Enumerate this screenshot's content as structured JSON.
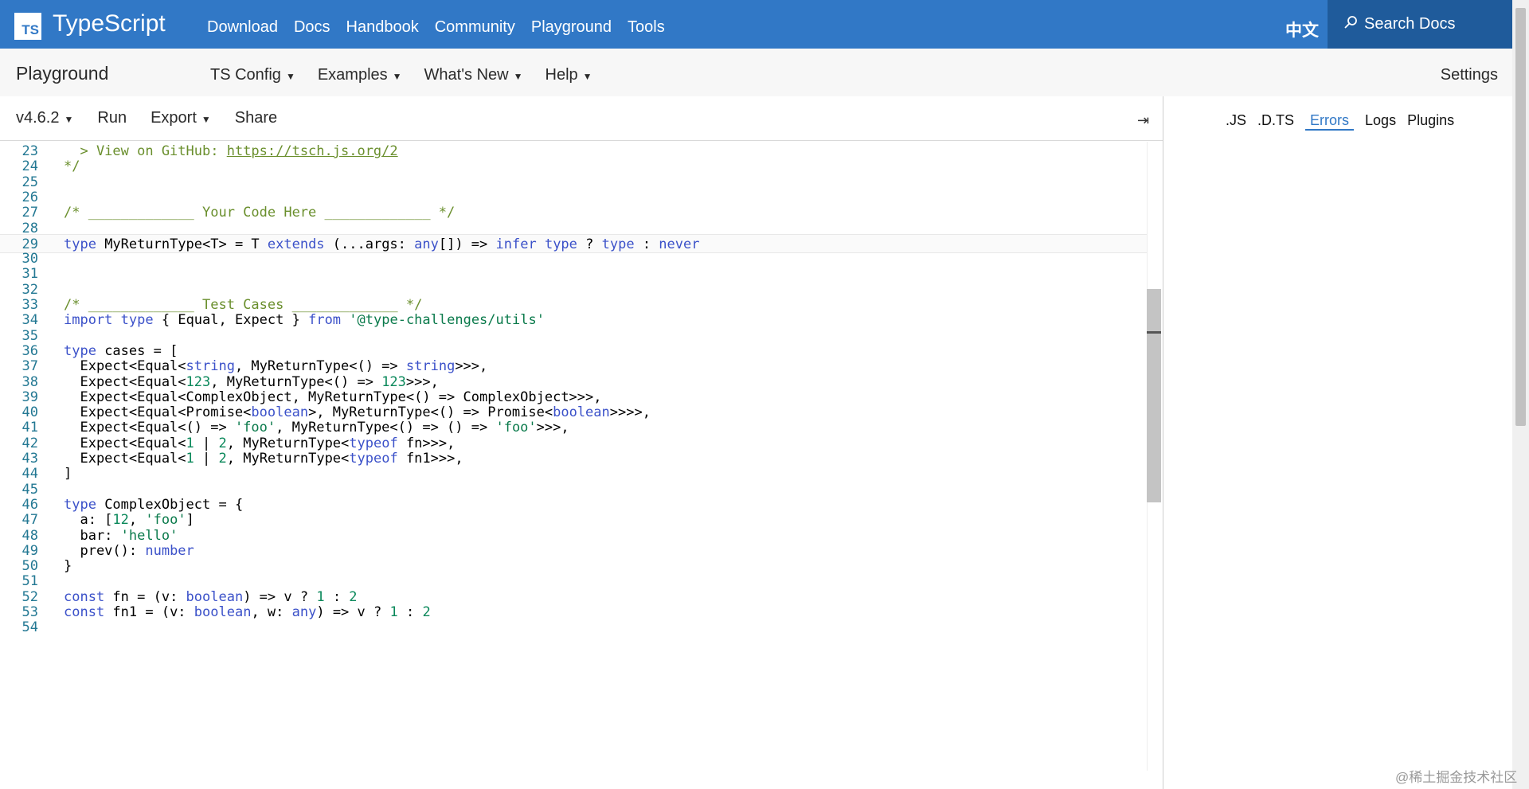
{
  "nav": {
    "logo_text": "TS",
    "brand": "TypeScript",
    "links": [
      "Download",
      "Docs",
      "Handbook",
      "Community",
      "Playground",
      "Tools"
    ],
    "lang": "中文",
    "search_label": "Search Docs"
  },
  "secondbar": {
    "title": "Playground",
    "menus": [
      "TS Config",
      "Examples",
      "What's New",
      "Help"
    ],
    "settings": "Settings"
  },
  "toolbar": {
    "version": "v4.6.2",
    "run": "Run",
    "export": "Export",
    "share": "Share",
    "collapse_icon": "⇥"
  },
  "right_tabs": [
    ".JS",
    ".D.TS",
    "Errors",
    "Logs",
    "Plugins"
  ],
  "right_tabs_active": "Errors",
  "editor": {
    "line_numbers": [
      "23",
      "24",
      "25",
      "26",
      "27",
      "28",
      "29",
      "30",
      "31",
      "32",
      "33",
      "34",
      "35",
      "36",
      "37",
      "38",
      "39",
      "40",
      "41",
      "42",
      "43",
      "44",
      "45",
      "46",
      "47",
      "48",
      "49",
      "50",
      "51",
      "52",
      "53",
      "54"
    ],
    "lines": [
      "  > View on GitHub: https://tsch.js.org/2",
      "*/",
      "",
      "",
      "/* _____________ Your Code Here _____________ */",
      "",
      "type MyReturnType<T> = T extends (...args: any[]) => infer type ? type : never",
      "",
      "",
      "",
      "/* _____________ Test Cases _____________ */",
      "import type { Equal, Expect } from '@type-challenges/utils'",
      "",
      "type cases = [",
      "  Expect<Equal<string, MyReturnType<() => string>>>,",
      "  Expect<Equal<123, MyReturnType<() => 123>>>,",
      "  Expect<Equal<ComplexObject, MyReturnType<() => ComplexObject>>>,",
      "  Expect<Equal<Promise<boolean>, MyReturnType<() => Promise<boolean>>>>,",
      "  Expect<Equal<() => 'foo', MyReturnType<() => () => 'foo'>>>,",
      "  Expect<Equal<1 | 2, MyReturnType<typeof fn>>>,",
      "  Expect<Equal<1 | 2, MyReturnType<typeof fn1>>>,",
      "]",
      "",
      "type ComplexObject = {",
      "  a: [12, 'foo']",
      "  bar: 'hello'",
      "  prev(): number",
      "}",
      "",
      "const fn = (v: boolean) => v ? 1 : 2",
      "const fn1 = (v: boolean, w: any) => v ? 1 : 2",
      ""
    ],
    "current_line": "29"
  },
  "watermark": "@稀土掘金技术社区"
}
